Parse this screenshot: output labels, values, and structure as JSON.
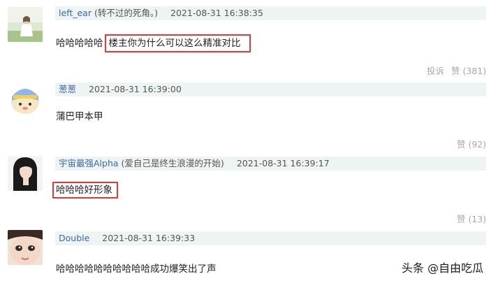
{
  "comments": [
    {
      "username": "left_ear",
      "signature": "(转不过的死角。)",
      "timestamp": "2021-08-31 16:38:35",
      "text_plain": "哈哈哈哈哈",
      "text_highlight": "楼主你为什么可以这么精准对比",
      "report_label": "投诉",
      "like_label": "赞",
      "like_count": "(381)"
    },
    {
      "username": "葱葱",
      "signature": "",
      "timestamp": "2021-08-31 16:39:00",
      "text": "蒲巴甲本甲",
      "like_label": "赞",
      "like_count": "(92)"
    },
    {
      "username": "宇宙最强Alpha",
      "signature": "(爱自己是终生浪漫的开始)",
      "timestamp": "2021-08-31 16:39:17",
      "text_highlight": "哈哈哈好形象",
      "like_label": "赞",
      "like_count": "(13)"
    },
    {
      "username": "Double",
      "signature": "",
      "timestamp": "2021-08-31 16:39:33",
      "text": "哈哈哈哈哈哈哈哈哈哈成功爆笑出了声"
    }
  ],
  "watermark": "头条 @自由吃瓜"
}
